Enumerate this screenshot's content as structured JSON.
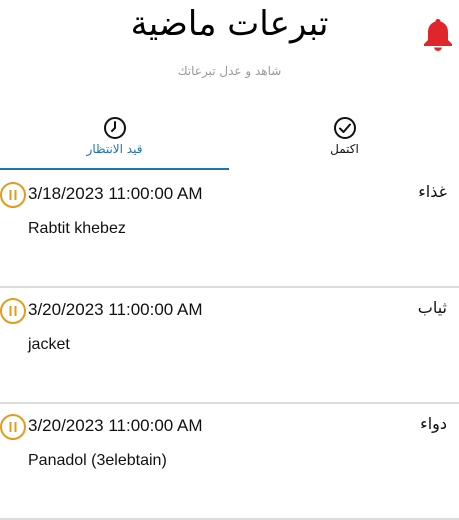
{
  "header": {
    "title": "تبرعات ماضية",
    "subtitle": "شاهد و عدل تبرعاتك",
    "bell_icon": "bell-icon",
    "bell_color": "#e0252b"
  },
  "tabs": [
    {
      "label": "قيد الانتظار",
      "icon": "clock-icon",
      "selected": true
    },
    {
      "label": "اكتمل",
      "icon": "check-circle-icon",
      "selected": false
    }
  ],
  "accent": "#1f73b7",
  "status_color": "#e39b1b",
  "donations": [
    {
      "category": "غذاء",
      "date": "3/18/2023 11:00:00 AM",
      "item": "Rabtit khebez",
      "status_icon": "pause-icon"
    },
    {
      "category": "ثياب",
      "date": "3/20/2023 11:00:00 AM",
      "item": "jacket",
      "status_icon": "pause-icon"
    },
    {
      "category": "دواء",
      "date": "3/20/2023 11:00:00 AM",
      "item": "Panadol (3elebtain)",
      "status_icon": "pause-icon"
    }
  ]
}
